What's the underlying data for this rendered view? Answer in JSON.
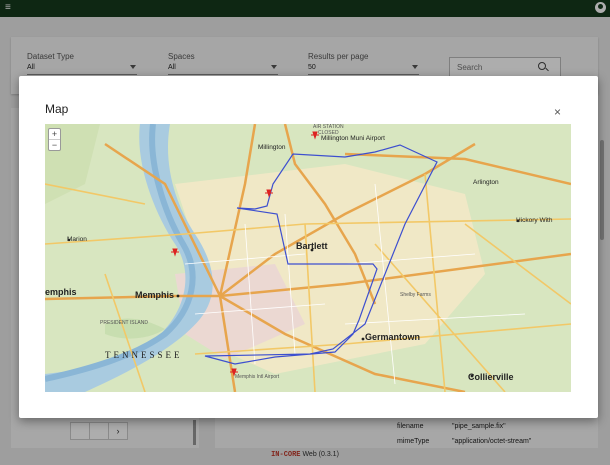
{
  "topbar": {
    "menu_icon": "hamburger-icon",
    "account_icon": "account-circle-icon"
  },
  "filters": {
    "dataset_type": {
      "label": "Dataset Type",
      "value": "All"
    },
    "spaces": {
      "label": "Spaces",
      "value": "All"
    },
    "results_per_page": {
      "label": "Results per page",
      "value": "50"
    },
    "search": {
      "placeholder": "Search"
    }
  },
  "pager": {
    "first": "",
    "current": "",
    "next": "›"
  },
  "metadata": [
    {
      "key": "filename",
      "value": "\"pipe_sample.fix\""
    },
    {
      "key": "mimeType",
      "value": "\"application/octet-stream\""
    }
  ],
  "footer": {
    "brand": "IN-CORE",
    "text": "Web (0.3.1)"
  },
  "modal": {
    "title": "Map",
    "close_label": "×"
  },
  "map": {
    "zoom_in": "+",
    "zoom_out": "−",
    "labels": {
      "millington": "Millington",
      "millington_airport": "Millington Muni Airport",
      "airstation": "AIR STATION",
      "closed": "CLOSED",
      "arlington": "Arlington",
      "hickory": "Hickory With",
      "bartlett": "Bartlett",
      "memphis": "Memphis",
      "marion": "Marion",
      "emphis": "emphis",
      "germantown": "Germantown",
      "collierville": "Collierville",
      "tennessee": "TENNESSEE",
      "memphis_intl": "Memphis Intl Airport",
      "president_island": "PRESIDENT ISLAND",
      "shelby": "Shelby Farms"
    }
  }
}
